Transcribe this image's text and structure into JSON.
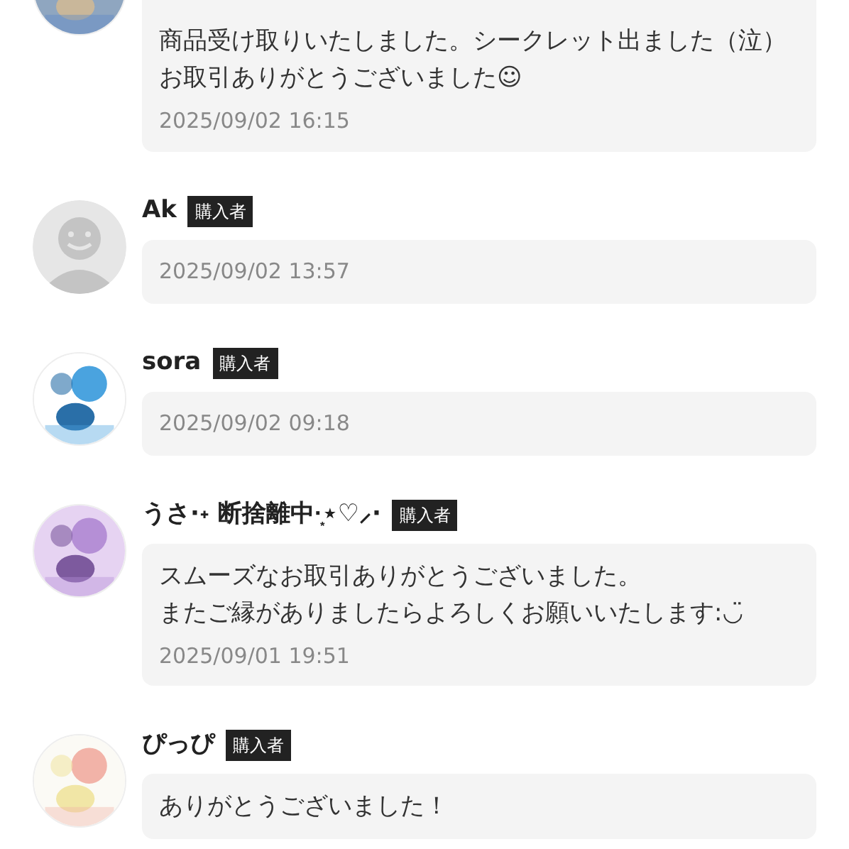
{
  "reviews": [
    {
      "message": "商品受け取りいたしました。シークレット出ました（泣）お取引ありがとうございました☺",
      "time": "2025/09/02 16:15"
    },
    {
      "name": "Ak",
      "badge": "購入者",
      "avatar": {
        "kind": "default"
      },
      "time": "2025/09/02 13:57"
    },
    {
      "name": "sora",
      "badge": "購入者",
      "time": "2025/09/02 09:18"
    },
    {
      "name": "うさ·˖ 断捨離中·͙⋆♡⸝·",
      "badge": "購入者",
      "message_lines": [
        "スムーズなお取引ありがとうございました。",
        "またご縁がありましたらよろしくお願いいたします:◡̈"
      ],
      "time": "2025/09/01 19:51"
    },
    {
      "name": "ぴっぴ",
      "badge": "購入者",
      "message": "ありがとうございました！"
    }
  ]
}
